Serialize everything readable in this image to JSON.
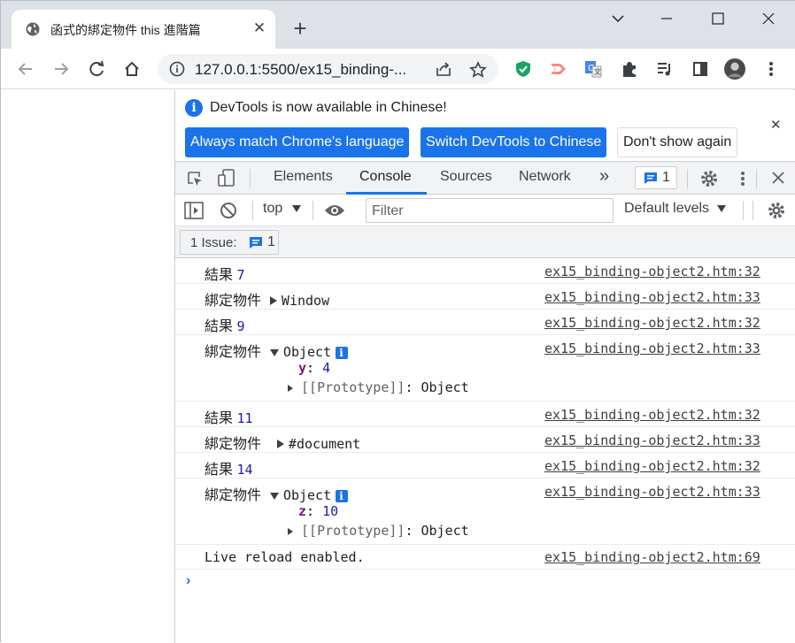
{
  "browser": {
    "tab_title": "函式的綁定物件 this 進階篇",
    "tab_close": "✕",
    "new_tab": "+",
    "url": "127.0.0.1:5500/ex15_binding-..."
  },
  "infobar": {
    "message": "DevTools is now available in Chinese!",
    "btn_match": "Always match Chrome's language",
    "btn_switch": "Switch DevTools to Chinese",
    "btn_dismiss": "Don't show again",
    "close": "✕"
  },
  "devtools_tabs": {
    "elements": "Elements",
    "console": "Console",
    "sources": "Sources",
    "network": "Network",
    "more": "»",
    "issues_count": "1"
  },
  "filterbar": {
    "context": "top",
    "filter_placeholder": "Filter",
    "levels": "Default levels"
  },
  "issuebar": {
    "label": "1 Issue:",
    "count": "1"
  },
  "console": {
    "messages": [
      {
        "label": "結果",
        "value": "7",
        "source": "ex15_binding-object2.htm:32"
      },
      {
        "label": "綁定物件",
        "value": "Window",
        "source": "ex15_binding-object2.htm:33"
      },
      {
        "label": "結果",
        "value": "9",
        "source": "ex15_binding-object2.htm:32"
      },
      {
        "label": "綁定物件",
        "value": "Object",
        "source": "ex15_binding-object2.htm:33",
        "prop_key": "y",
        "prop_value": "4",
        "proto": "[[Prototype]]",
        "proto_value": "Object"
      },
      {
        "label": "結果",
        "value": "11",
        "source": "ex15_binding-object2.htm:32"
      },
      {
        "label": "綁定物件",
        "value": "#document",
        "source": "ex15_binding-object2.htm:33"
      },
      {
        "label": "結果",
        "value": "14",
        "source": "ex15_binding-object2.htm:32"
      },
      {
        "label": "綁定物件",
        "value": "Object",
        "source": "ex15_binding-object2.htm:33",
        "prop_key": "z",
        "prop_value": "10",
        "proto": "[[Prototype]]",
        "proto_value": "Object"
      },
      {
        "label": "Live reload enabled.",
        "source": "ex15_binding-object2.htm:69"
      }
    ],
    "prompt": "›"
  },
  "colors": {
    "accent": "#1a73e8",
    "number": "#1a1aa6",
    "property_key": "#881280"
  }
}
